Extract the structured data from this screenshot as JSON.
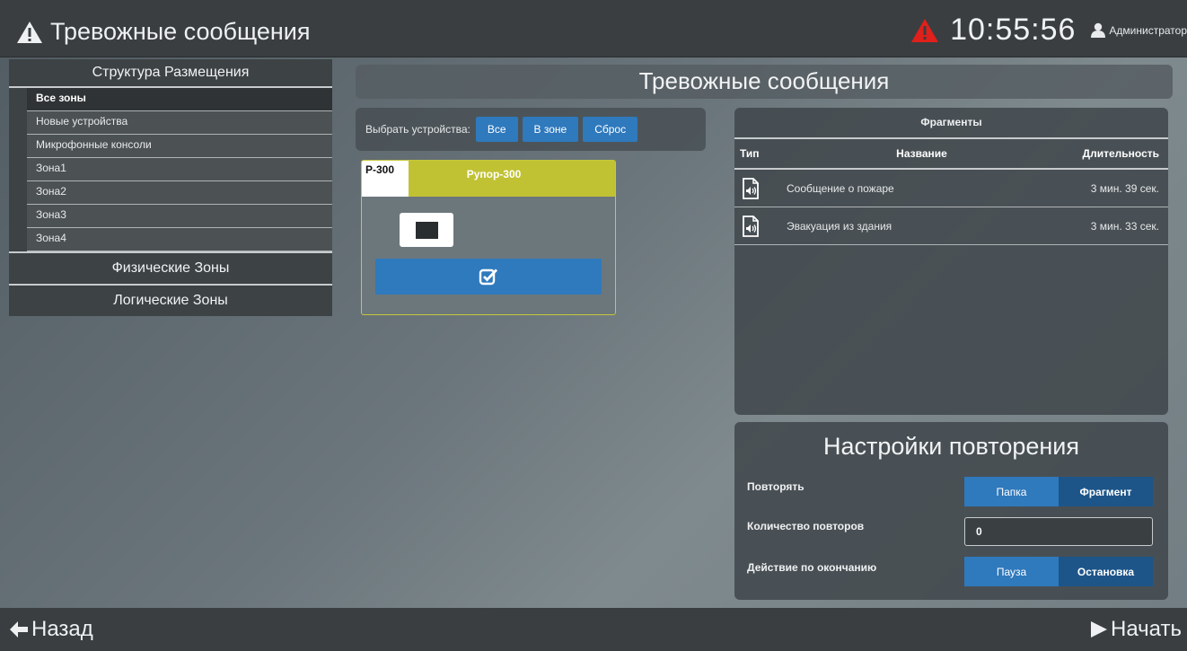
{
  "header": {
    "title": "Тревожные сообщения",
    "clock": "10:55:56",
    "user": "Администратор"
  },
  "nav": {
    "structure_label": "Структура Размещения",
    "zones": [
      {
        "label": "Все зоны",
        "active": true
      },
      {
        "label": "Новые устройства"
      },
      {
        "label": "Микрофонные консоли"
      },
      {
        "label": "Зона1"
      },
      {
        "label": "Зона2"
      },
      {
        "label": "Зона3"
      },
      {
        "label": "Зона4"
      }
    ],
    "physical_label": "Физические Зоны",
    "logical_label": "Логические Зоны"
  },
  "main": {
    "title": "Тревожные сообщения",
    "select_label": "Выбрать устройства:",
    "buttons": {
      "all": "Все",
      "in_zone": "В зоне",
      "reset": "Сброс"
    },
    "device": {
      "code": "Р-300",
      "name": "Рупор-300"
    }
  },
  "fragments": {
    "title": "Фрагменты",
    "columns": {
      "type": "Тип",
      "name": "Название",
      "duration": "Длительность"
    },
    "rows": [
      {
        "name": "Сообщение о пожаре",
        "duration": "3 мин. 39 сек."
      },
      {
        "name": "Эвакуация из здания",
        "duration": "3 мин. 33 сек."
      }
    ]
  },
  "repeat": {
    "title": "Настройки повторения",
    "repeat_label": "Повторять",
    "repeat_options": [
      "Папка",
      "Фрагмент"
    ],
    "count_label": "Количество повторов",
    "count_value": "0",
    "end_action_label": "Действие по окончанию",
    "end_action_options": [
      "Пауза",
      "Остановка"
    ]
  },
  "footer": {
    "back": "Назад",
    "start": "Начать"
  },
  "colors": {
    "accent_blue": "#2f79bd",
    "selected_blue": "#1d5589",
    "device_header": "#c0c233",
    "alarm_red": "#e0201b"
  }
}
